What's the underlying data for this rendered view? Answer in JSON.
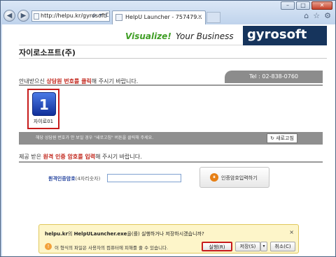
{
  "browser": {
    "address_url": "http://helpu.kr/gyrosoft/",
    "address_tools": "ρ ▾ C ×",
    "tab_title": "HelpU Launcher - 757479...",
    "tab_close": "×",
    "window_buttons": {
      "minimize": "–",
      "maximize": "□",
      "close": "✕"
    },
    "toolbar_icons": [
      "home-icon",
      "star-icon",
      "gear-icon"
    ]
  },
  "banner": {
    "slogan_green": "Visualize!",
    "slogan_dark": "Your Business",
    "logo_text": "gyrosoft"
  },
  "company_name": "자이로소프트(주)",
  "section1": {
    "title_prefix": "안내받으신 ",
    "title_highlight": "상담원 번호를 클릭",
    "title_suffix": "해 주시기 바랍니다.",
    "tel": "Tel : 02-838-0760",
    "agent": {
      "number": "1",
      "name": "자이로01"
    },
    "notice": "해당 상담원 번호가 안 보일 경우 \"새로고침\" 버튼을 클릭해 주세요.",
    "refresh_label": "새로고침"
  },
  "section2": {
    "title_prefix": "제공 받은 ",
    "title_highlight": "원격 인증 암호를 입력",
    "title_suffix": "해 주시기 바랍니다.",
    "field_label": "원격인증암호",
    "field_hint": "(4자리숫자)",
    "field_value": "",
    "submit_label": "인증암호입력하기"
  },
  "download_bar": {
    "msg_host": "helpu.kr",
    "msg_mid": "의 ",
    "msg_file": "HelpULauncher.exe",
    "msg_end": "을(를) 실행하거나 저장하시겠습니까?",
    "warning": "이 형식의 파일은 사용자의 컴퓨터에 피해를 줄 수 있습니다.",
    "run_label": "실행(R)",
    "save_label": "저장(S)",
    "save_arrow": "▾",
    "cancel_label": "취소(C)",
    "close": "×"
  }
}
